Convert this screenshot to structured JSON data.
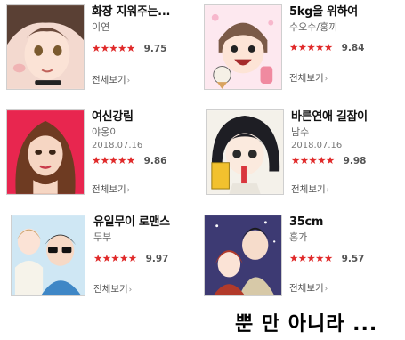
{
  "items": [
    {
      "title": "화장 지워주는...",
      "author": "이연",
      "date": "",
      "stars": "★★★★★",
      "score": "9.75",
      "more": "전체보기",
      "chevron": "›"
    },
    {
      "title": "5kg을 위하여",
      "author": "수오수/홍끼",
      "date": "",
      "stars": "★★★★★",
      "score": "9.84",
      "more": "전체보기",
      "chevron": "›"
    },
    {
      "title": "여신강림",
      "author": "야옹이",
      "date": "2018.07.16",
      "stars": "★★★★★",
      "score": "9.86",
      "more": "전체보기",
      "chevron": "›"
    },
    {
      "title": "바른연애 길잡이",
      "author": "남수",
      "date": "2018.07.16",
      "stars": "★★★★★",
      "score": "9.98",
      "more": "전체보기",
      "chevron": "›"
    },
    {
      "title": "유일무이 로맨스",
      "author": "두부",
      "date": "",
      "stars": "★★★★★",
      "score": "9.97",
      "more": "전체보기",
      "chevron": "›"
    },
    {
      "title": "35cm",
      "author": "홍가",
      "date": "",
      "stars": "★★★★★",
      "score": "9.57",
      "more": "전체보기",
      "chevron": "›"
    }
  ],
  "footer_text": "뿐 만 아니라 ...",
  "colors": {
    "star": "#e02a2a",
    "thumb_border": "#cfcfcf"
  }
}
